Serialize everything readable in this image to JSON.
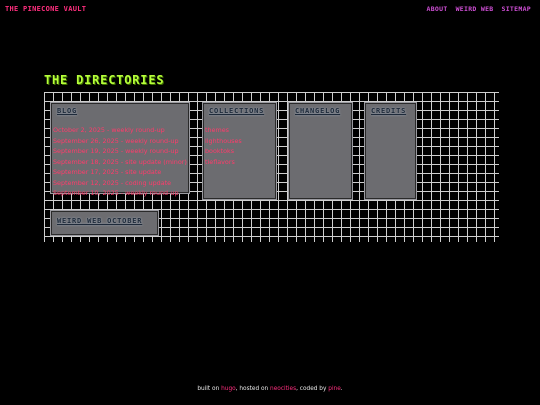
{
  "header": {
    "site_title": "THE PINECONE VAULT",
    "nav": [
      "ABOUT",
      "WEIRD WEB",
      "SITEMAP"
    ]
  },
  "main": {
    "section_title": "THE DIRECTORIES",
    "cards": {
      "blog": {
        "title": "BLOG",
        "items": [
          "October 2, 2025 - weekly round-up",
          "September 26, 2025 - weekly round-up",
          "September 19, 2025 - weekly round-up",
          "September 18, 2025 - site update (minor)",
          "September 17, 2025 - site update",
          "September 12, 2025 - coding update",
          "September 10, 2025 - weekly round-up"
        ]
      },
      "collections": {
        "title": "COLLECTIONS",
        "items": [
          "themes",
          "lighthouses",
          "booktoks",
          "tieflavors"
        ]
      },
      "changelog": {
        "title": "CHANGELOG"
      },
      "credits": {
        "title": "CREDITS"
      },
      "weird_web": {
        "title": "WEIRD WEB OCTOBER"
      }
    }
  },
  "footer": {
    "prefix": "built on",
    "link1": "hugo",
    "mid1": ", hosted on",
    "link2": "neocities",
    "mid2": ", coded by",
    "link3": "pine",
    "suffix": "."
  },
  "colors": {
    "site_title": "#ff2e7e",
    "nav": "#d04fd6",
    "section_title": "#b6ff3a",
    "card_bg": "#6c6c70",
    "card_title": "#1e2a3a",
    "link": "#ff3b6b",
    "grid_line": "#cfcfcf"
  }
}
